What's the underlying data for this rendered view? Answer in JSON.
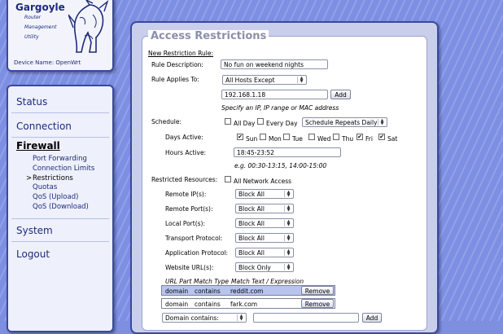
{
  "brand": {
    "title": "Gargoyle",
    "sub1": "Router",
    "sub2": "Management",
    "sub3": "Utility",
    "device": "Device Name: OpenWrt"
  },
  "nav": {
    "status": "Status",
    "connection": "Connection",
    "firewall": "Firewall",
    "sub": {
      "port_forwarding": "Port Forwarding",
      "connection_limits": "Connection Limits",
      "restrictions": "Restrictions",
      "quotas": "Quotas",
      "qos_upload": "QoS (Upload)",
      "qos_download": "QoS (Download)"
    },
    "system": "System",
    "logout": "Logout",
    "current_marker": ">"
  },
  "panel": {
    "title": "Access Restrictions",
    "new_rule": "New Restriction Rule:",
    "rule_desc_label": "Rule Description:",
    "rule_desc_value": "No fun on weekend nights",
    "applies_label": "Rule Applies To:",
    "applies_value": "All Hosts Except",
    "ip_value": "192.168.1.18",
    "add_label": "Add",
    "ip_hint": "Specify an IP, IP range or MAC address",
    "schedule_label": "Schedule:",
    "all_day": "All Day",
    "every_day": "Every Day",
    "schedule_select": "Schedule Repeats Daily",
    "days_active_label": "Days Active:",
    "days": [
      {
        "name": "Sun",
        "checked": true
      },
      {
        "name": "Mon",
        "checked": false
      },
      {
        "name": "Tue",
        "checked": false
      },
      {
        "name": "Wed",
        "checked": false
      },
      {
        "name": "Thu",
        "checked": false
      },
      {
        "name": "Fri",
        "checked": true
      },
      {
        "name": "Sat",
        "checked": true
      }
    ],
    "hours_label": "Hours Active:",
    "hours_value": "18:45-23:52",
    "hours_hint": "e.g. 00:30-13:15, 14:00-15:00",
    "restricted_label": "Restricted Resources:",
    "all_network": "All Network Access",
    "resources": [
      {
        "label": "Remote IP(s):",
        "value": "Block All"
      },
      {
        "label": "Remote Port(s):",
        "value": "Block All"
      },
      {
        "label": "Local Port(s):",
        "value": "Block All"
      },
      {
        "label": "Transport Protocol:",
        "value": "Block All"
      },
      {
        "label": "Application Protocol:",
        "value": "Block All"
      },
      {
        "label": "Website URL(s):",
        "value": "Block Only"
      }
    ],
    "table_headers": {
      "part": "URL Part",
      "match": "Match Type",
      "text": "Match Text / Expression"
    },
    "url_rows": [
      {
        "part": "domain",
        "match": "contains",
        "text": "reddit.com",
        "action": "Remove",
        "selected": true
      },
      {
        "part": "domain",
        "match": "contains",
        "text": "fark.com",
        "action": "Remove",
        "selected": false
      }
    ],
    "new_url_select": "Domain contains:",
    "new_url_add": "Add"
  },
  "colors": {
    "background": "#7d8fe2",
    "nav_text": "#1d2b7a",
    "panel_bg": "#c9cfeb",
    "selected_row": "#b7c4ee"
  }
}
